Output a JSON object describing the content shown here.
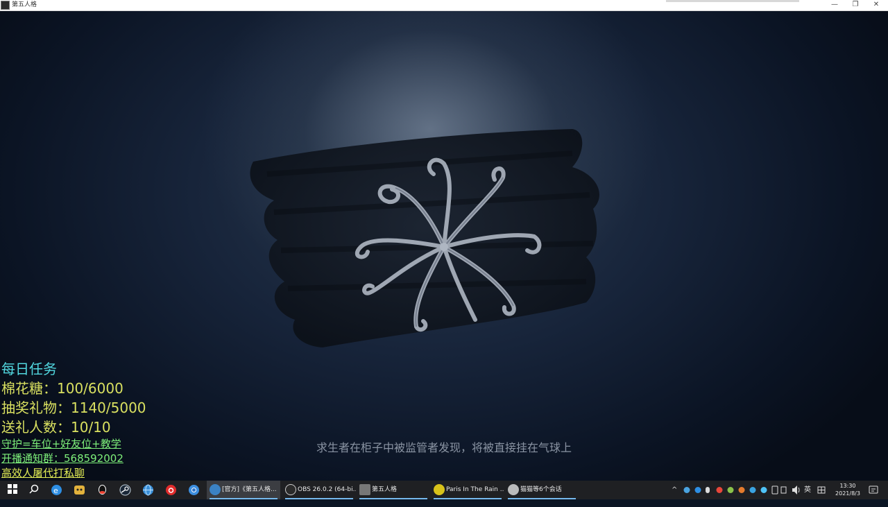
{
  "window": {
    "title": "第五人格",
    "controls": {
      "minimize": "—",
      "maximize": "❐",
      "close": "✕"
    }
  },
  "scene": {
    "loading_tip": "求生者在柜子中被监管者发现，将被直接挂在气球上"
  },
  "overlay": {
    "heading": "每日任务",
    "lines": [
      "棉花糖：100/6000",
      "抽奖礼物：1140/5000",
      "送礼人数：10/10"
    ],
    "small_lines": [
      "守护=车位+好友位+教学",
      "开播通知群：568592002",
      "高效人屠代打私聊"
    ]
  },
  "taskbar": {
    "start_icon": "windows-logo-icon",
    "pinned": [
      "search-icon",
      "edge-browser-icon",
      "game-launcher-icon",
      "qq-icon",
      "steam-icon",
      "globe-browser-icon",
      "netease-music-icon",
      "chrome-icon"
    ],
    "tasks": [
      {
        "label": "[官方]《第五人格...",
        "color": "#3b82c4",
        "active": true
      },
      {
        "label": "OBS 26.0.2 (64-bi...",
        "color": "#2b2b2b",
        "active": false
      },
      {
        "label": "第五人格",
        "color": "#777777",
        "active": false
      },
      {
        "label": "Paris In The Rain ...",
        "color": "#d8c21a",
        "active": false
      },
      {
        "label": "猫猫等6个会话",
        "color": "#bbbbbb",
        "active": false
      }
    ],
    "tray": {
      "chevron": "^",
      "ime": "英",
      "time": "13:30",
      "date": "2021/8/3"
    }
  }
}
